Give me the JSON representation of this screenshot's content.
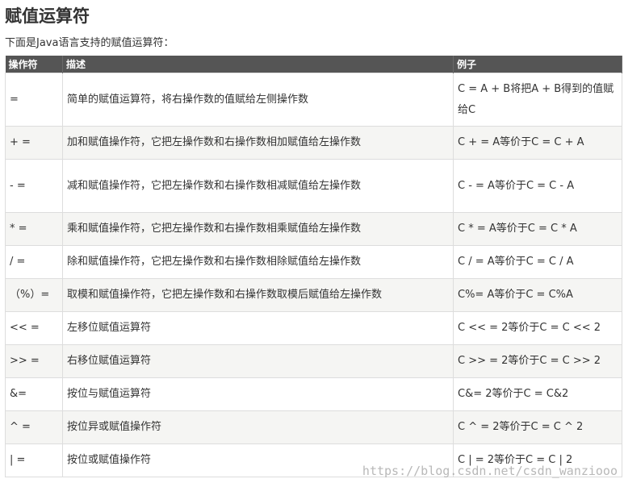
{
  "page": {
    "title": "赋值运算符",
    "intro": "下面是Java语言支持的赋值运算符："
  },
  "table": {
    "headers": {
      "operator": "操作符",
      "description": "描述",
      "example": "例子"
    },
    "rows": [
      {
        "operator": "=",
        "description": "简单的赋值运算符，将右操作数的值赋给左侧操作数",
        "example": "C = A + B将把A + B得到的值赋给C"
      },
      {
        "operator": "+ =",
        "description": "加和赋值操作符，它把左操作数和右操作数相加赋值给左操作数",
        "example": "C + = A等价于C = C + A"
      },
      {
        "operator": "- =",
        "description": "减和赋值操作符，它把左操作数和右操作数相减赋值给左操作数",
        "example": "C - = A等价于C = C - A"
      },
      {
        "operator": "* =",
        "description": "乘和赋值操作符，它把左操作数和右操作数相乘赋值给左操作数",
        "example": "C * = A等价于C = C * A"
      },
      {
        "operator": "/ =",
        "description": "除和赋值操作符，它把左操作数和右操作数相除赋值给左操作数",
        "example": "C / = A等价于C = C / A"
      },
      {
        "operator": "（%）=",
        "description": "取模和赋值操作符，它把左操作数和右操作数取模后赋值给左操作数",
        "example": "C%= A等价于C = C%A"
      },
      {
        "operator": "<< =",
        "description": "左移位赋值运算符",
        "example": "C << = 2等价于C = C << 2"
      },
      {
        "operator": ">> =",
        "description": "右移位赋值运算符",
        "example": "C >> = 2等价于C = C >> 2"
      },
      {
        "operator": "&=",
        "description": "按位与赋值运算符",
        "example": "C&= 2等价于C = C&2"
      },
      {
        "operator": "^ =",
        "description": "按位异或赋值操作符",
        "example": "C ^ = 2等价于C = C ^ 2"
      },
      {
        "operator": "| =",
        "description": "按位或赋值操作符",
        "example": "C | = 2等价于C = C | 2"
      }
    ]
  },
  "watermark": "https://blog.csdn.net/csdn_wanziooo",
  "colors": {
    "header_bg": "#555555",
    "header_text": "#ffffff",
    "row_alt_bg": "#f5f5f3",
    "border": "#dddddd"
  }
}
